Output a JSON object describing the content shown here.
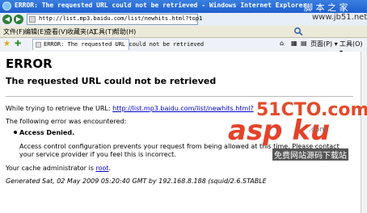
{
  "window": {
    "title": "ERROR: The requested URL could not be retrieved - Windows Internet Explorer",
    "watermark_site": "脚 本 之 家"
  },
  "address_bar": {
    "url": "http://list.mp3.baidu.com/list/newhits.html?top1"
  },
  "site_watermark2": "www.jb51.net",
  "menu": {
    "items": [
      "文件(F)",
      "编辑(E)",
      "查看(V)",
      "收藏夹(A)",
      "工具(T)",
      "帮助(H)"
    ]
  },
  "tab": {
    "label": "ERROR: The requested URL could not be retrieved"
  },
  "toolbar": {
    "page_label": "页面(P) ▾",
    "tools_label": "工具(O) ▾"
  },
  "page": {
    "heading": "ERROR",
    "subheading": "The requested URL could not be retrieved",
    "retrieve_prefix": "While trying to retrieve the URL: ",
    "retrieve_url": "http://list.mp3.baidu.com/list/newhits.html?",
    "error_intro": "The following error was encountered:",
    "error_title": "Access Denied.",
    "error_detail": "Access control configuration prevents your request from being allowed at this time. Please contact your service provider if you feel this is incorrect.",
    "admin_prefix": "Your cache administrator is ",
    "admin_link": "root",
    "admin_suffix": ".",
    "generated": "Generated Sat, 02 May 2009 05:20:40 GMT by 192.168.8.188 (squid/2.6.STABLE"
  },
  "watermark": {
    "number": "51CTO.com",
    "brand": "asp ku",
    "domain": ".com",
    "slogan": "免费网站源码下载站"
  }
}
